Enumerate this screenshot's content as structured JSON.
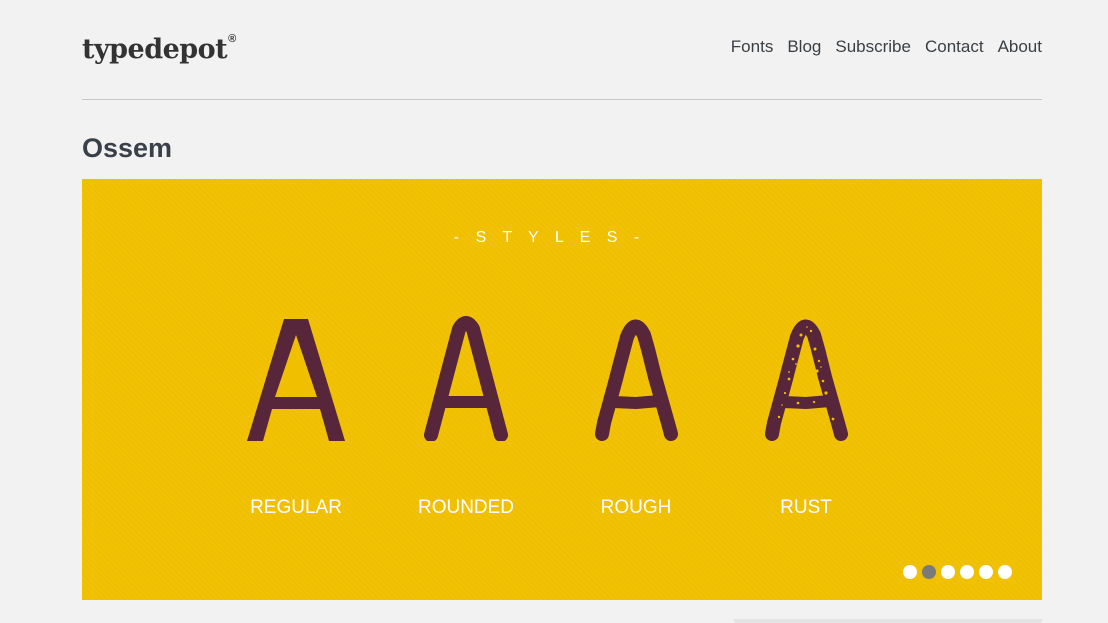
{
  "site": {
    "logo_text": "typedepot",
    "logo_mark": "®"
  },
  "nav": {
    "items": [
      {
        "label": "Fonts"
      },
      {
        "label": "Blog"
      },
      {
        "label": "Subscribe"
      },
      {
        "label": "Contact"
      },
      {
        "label": "About"
      }
    ]
  },
  "page": {
    "title": "Ossem"
  },
  "slider": {
    "heading": "- S T Y L E S -",
    "background_color": "#f0c000",
    "glyph_color": "#57263a",
    "styles": [
      {
        "label": "REGULAR",
        "glyph": "A"
      },
      {
        "label": "ROUNDED",
        "glyph": "A"
      },
      {
        "label": "ROUGH",
        "glyph": "A"
      },
      {
        "label": "RUST",
        "glyph": "A"
      }
    ],
    "pager": {
      "count": 6,
      "active_index": 1
    }
  }
}
